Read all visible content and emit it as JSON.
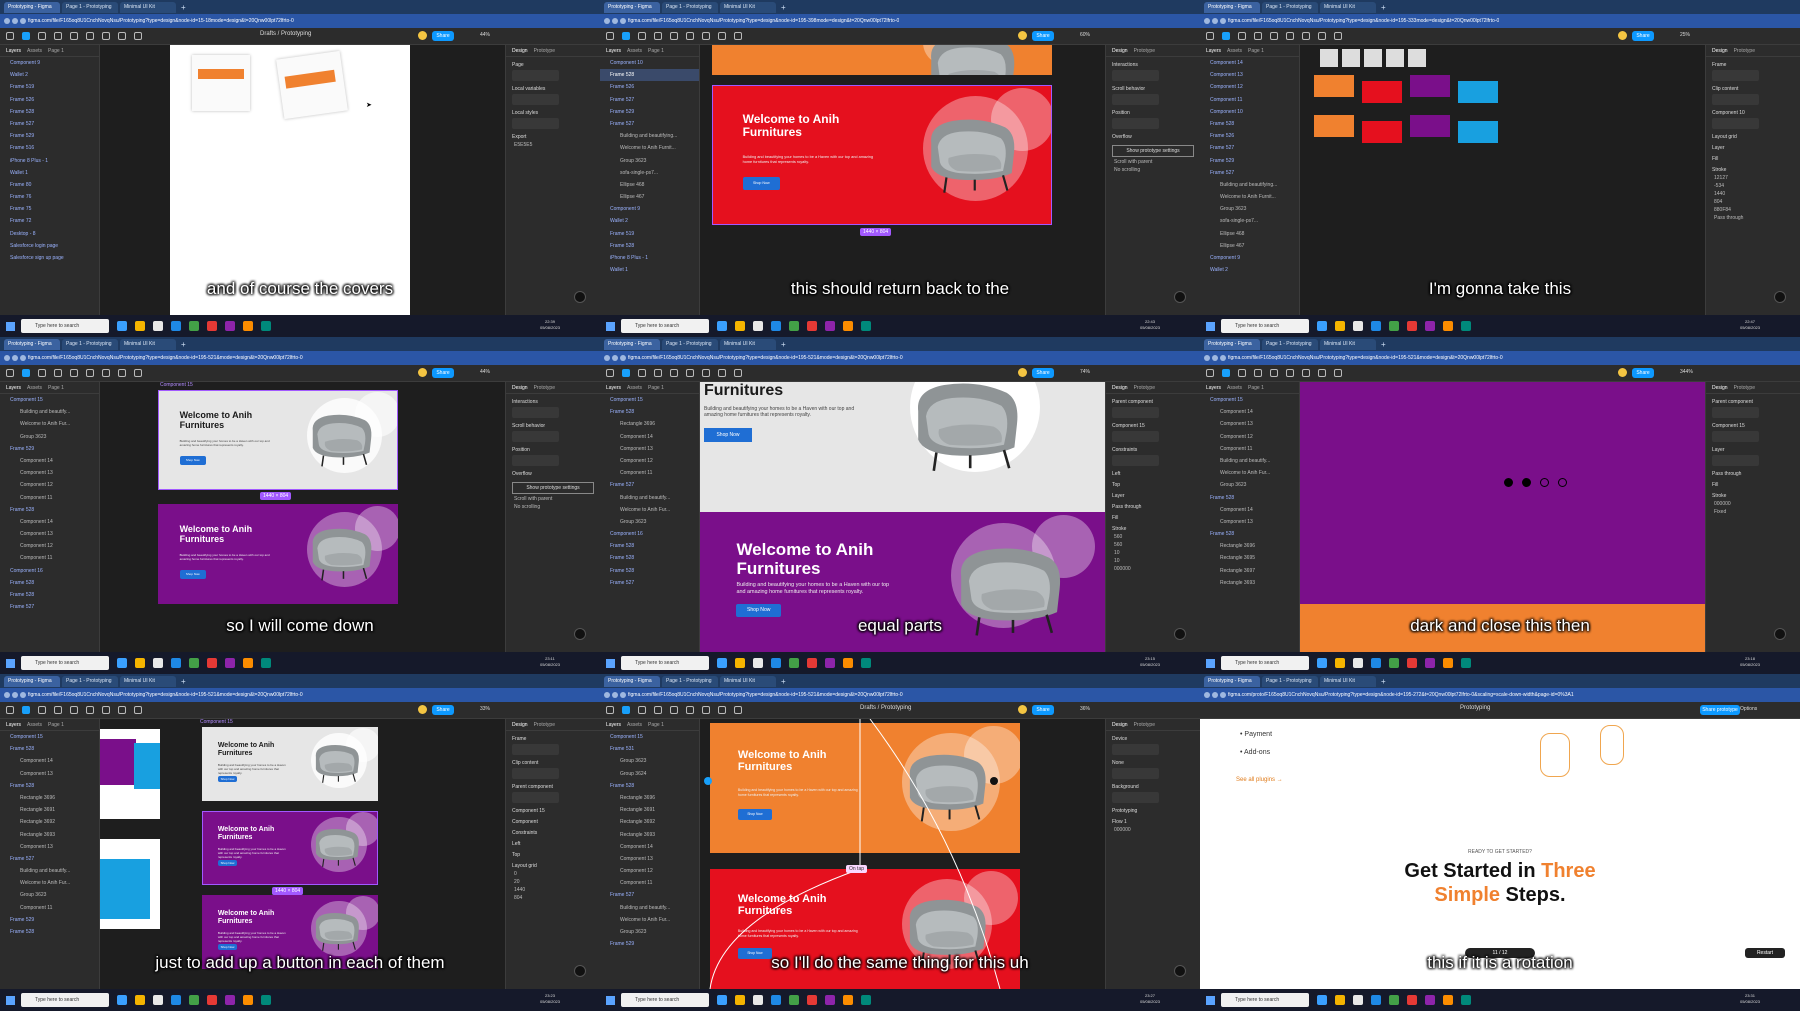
{
  "colors": {
    "figma_blue": "#18a0fb",
    "orange": "#f0812f",
    "red": "#e5101e",
    "purple": "#7a0f8a",
    "selection_purple": "#a259ff",
    "button_blue": "#1f6ed4"
  },
  "common": {
    "tab1": "Prototyping - Figma",
    "tab2": "Page 1 - Prototyping",
    "tab3": "Minimal UI Kit",
    "share": "Share",
    "search": "Type here to search",
    "design_tab": "Design",
    "prototype_tab": "Prototype",
    "layers_tab": "Layers",
    "assets_tab": "Assets",
    "page_tab": "Page 1",
    "date": "05/08/2023",
    "headline": "Welcome to Anih Furnitures",
    "body_text": "Building and beautifying your homes to be a Haven with our top and amazing home furnitures that represents royalty.",
    "shop_now": "Shop Now"
  },
  "cells": [
    {
      "url": "figma.com/file/F165oq8U1CnchNovqNsu/Prototyping?type=design&node-id=15-18mode=design&t=20Qnw00lpt72lfrto-0",
      "crumb": "Drafts / Prototyping",
      "zoom": "44%",
      "caption": "and of course the covers",
      "time": "22:39",
      "layers": [
        "Component 9",
        "Wallet 2",
        "Frame 519",
        "Frame 526",
        "Frame 528",
        "Frame 527",
        "Frame 529",
        "Frame 516",
        "iPhone 8 Plus - 1",
        "Wallet 1",
        "Frame 80",
        "Frame 76",
        "Frame 75",
        "Frame 72",
        "Desktop - 8",
        "Salesforce login page",
        "Salesforce sign up page"
      ],
      "right_labels": [
        "Page",
        "Local variables",
        "Local styles",
        "Export"
      ],
      "page_color": "E5E5E5"
    },
    {
      "url": "figma.com/file/F165oq8U1CnchNovqNsu/Prototyping?type=design&node-id=195-398mode=design&t=20Qnw00lpt72lfrto-0",
      "zoom": "60%",
      "caption": "this should return back to the",
      "time": "22:43",
      "layers": [
        "Component 10",
        "Frame 528",
        "Frame 526",
        "Frame 527",
        "Frame 529",
        "Frame 527",
        "Building and beautifying...",
        "Welcome to Anih Furnit...",
        "Group 3623",
        "sofa-single-ps7...",
        "Ellipse 468",
        "Ellipse 467",
        "Component 9",
        "Wallet 2",
        "Frame 519",
        "Frame 528",
        "iPhone 8 Plus - 1",
        "Wallet 1"
      ],
      "right_labels": [
        "Interactions",
        "Scroll behavior",
        "Position",
        "Overflow",
        "Show prototype settings"
      ],
      "position_value": "Scroll with parent",
      "overflow_value": "No scrolling",
      "dim": "1440 × 804"
    },
    {
      "url": "figma.com/file/F165oq8U1CnchNovqNsu/Prototyping?type=design&node-id=195-333mode=design&t=20Qnw00lpt72lfrto-0",
      "zoom": "25%",
      "caption": "I'm gonna take this",
      "time": "22:47",
      "layers": [
        "Component 14",
        "Component 13",
        "Component 12",
        "Component 11",
        "Component 10",
        "Frame 528",
        "Frame 526",
        "Frame 527",
        "Frame 529",
        "Frame 527",
        "Building and beautifying...",
        "Welcome to Anih Furnit...",
        "Group 3623",
        "sofa-single-ps7...",
        "Ellipse 468",
        "Ellipse 467",
        "Component 9",
        "Wallet 2"
      ],
      "right_labels": [
        "Frame",
        "Clip content",
        "Component 10",
        "Layout grid",
        "Layer",
        "Fill",
        "Stroke"
      ],
      "x": "12127",
      "y": "-534",
      "w": "1440",
      "h": "804",
      "fill": "880F84",
      "pass": "Pass through"
    },
    {
      "url": "figma.com/file/F165oq8U1CnchNovqNsu/Prototyping?type=design&node-id=195-521&mode=design&t=20Qnw00lpt72lfrto-0",
      "zoom": "44%",
      "caption": "so I will come down",
      "time": "23:11",
      "label": "Component 15",
      "layers": [
        "Component 15",
        "Building and beautify...",
        "Welcome to Anih Fur...",
        "Group 3623",
        "Frame 529",
        "Component 14",
        "Component 13",
        "Component 12",
        "Component 11",
        "Frame 528",
        "Component 14",
        "Component 13",
        "Component 12",
        "Component 11",
        "Component 16",
        "Frame 528",
        "Frame 528",
        "Frame 527"
      ],
      "right_labels": [
        "Interactions",
        "Scroll behavior",
        "Position",
        "Overflow",
        "Show prototype settings"
      ],
      "position_value": "Scroll with parent",
      "overflow_value": "No scrolling",
      "dim": "1440 × 804"
    },
    {
      "url": "figma.com/file/F165oq8U1CnchNovqNsu/Prototyping?type=design&node-id=195-521&mode=design&t=20Qnw00lpt72lfrto-0",
      "zoom": "74%",
      "caption": "equal parts",
      "time": "23:15",
      "layers": [
        "Component 15",
        "Frame 528",
        "Rectangle 3696",
        "Component 14",
        "Component 13",
        "Component 12",
        "Component 11",
        "Frame 527",
        "Building and beautify...",
        "Welcome to Anih Fur...",
        "Group 3623",
        "Component 16",
        "Frame 528",
        "Frame 528",
        "Frame 528",
        "Frame 527"
      ],
      "right_labels": [
        "Parent component",
        "Component 15",
        "Constraints",
        "Left",
        "Top",
        "Layer",
        "Pass through",
        "Fill",
        "Stroke"
      ],
      "x": "560",
      "y": "560",
      "w": "10",
      "h": "10",
      "fill": "000000"
    },
    {
      "url": "figma.com/file/F165oq8U1CnchNovqNsu/Prototyping?type=design&node-id=195-521&mode=design&t=20Qnw00lpt72lfrto-0",
      "zoom": "344%",
      "caption": "dark and close this then",
      "time": "23:18",
      "layers": [
        "Component 15",
        "Component 14",
        "Component 13",
        "Component 12",
        "Component 11",
        "Building and beautify...",
        "Welcome to Anih Fur...",
        "Group 3623",
        "Frame 528",
        "Component 14",
        "Component 13",
        "Frame 528",
        "Rectangle 3696",
        "Rectangle 3695",
        "Rectangle 3697",
        "Rectangle 3693"
      ],
      "right_labels": [
        "Parent component",
        "Component 15",
        "Layer",
        "Pass through",
        "Fill",
        "Stroke"
      ],
      "fill": "000000",
      "fixed": "Fixed"
    },
    {
      "url": "figma.com/file/F165oq8U1CnchNovqNsu/Prototyping?type=design&node-id=195-521&mode=design&t=20Qnw00lpt72lfrto-0",
      "zoom": "33%",
      "caption": "just to add up a button in each of them",
      "time": "23:23",
      "label": "Component 15",
      "layers": [
        "Component 15",
        "Frame 528",
        "Component 14",
        "Component 13",
        "Frame 528",
        "Rectangle 3696",
        "Rectangle 3691",
        "Rectangle 3692",
        "Rectangle 3693",
        "Component 13",
        "Frame 527",
        "Building and beautify...",
        "Welcome to Anih Fur...",
        "Group 3623",
        "Component 11",
        "Frame 529",
        "Frame 528"
      ],
      "right_labels": [
        "Frame",
        "Clip content",
        "Parent component",
        "Component 15",
        "Component",
        "Constraints",
        "Left",
        "Top",
        "Layout grid"
      ],
      "x": "0",
      "y": "20",
      "w": "1440",
      "h": "804",
      "dim": "1440 × 804"
    },
    {
      "url": "figma.com/file/F165oq8U1CnchNovqNsu/Prototyping?type=design&node-id=195-521&mode=design&t=20Qnw00lpt72lfrto-0",
      "crumb": "Drafts / Prototyping",
      "zoom": "36%",
      "caption": "so I'll do the same thing for this uh",
      "time": "23:27",
      "layers": [
        "Component 15",
        "Frame 531",
        "Group 3623",
        "Group 3624",
        "Frame 528",
        "Rectangle 3696",
        "Rectangle 3691",
        "Rectangle 3692",
        "Rectangle 3693",
        "Component 14",
        "Component 13",
        "Component 12",
        "Component 11",
        "Frame 527",
        "Building and beautify...",
        "Welcome to Anih Fur...",
        "Group 3623",
        "Frame 529"
      ],
      "right_labels": [
        "Device",
        "None",
        "Background",
        "Prototyping",
        "Flow 1"
      ],
      "bg": "000000",
      "onclick": "On tap"
    },
    {
      "url": "figma.com/proto/F165oq8U1CnchNovqNsu/Prototyping?type=design&node-id=195-272&t=20Qnw00lpt72lfrto-0&scaling=scale-down-width&page-id=0%3A1",
      "crumb": "Prototyping",
      "caption": "this if it is a rotation",
      "time": "23:31",
      "share_proto": "Share prototype",
      "options": "Options",
      "list": [
        "Payment",
        "Add-ons"
      ],
      "see_all": "See all plugins →",
      "ready": "READY TO GET STARTED?",
      "get1": "Get Started in",
      "get2": "Three",
      "get3": "Simple",
      "get4": "Steps.",
      "counter": "11 / 12",
      "restart": "Restart"
    }
  ]
}
